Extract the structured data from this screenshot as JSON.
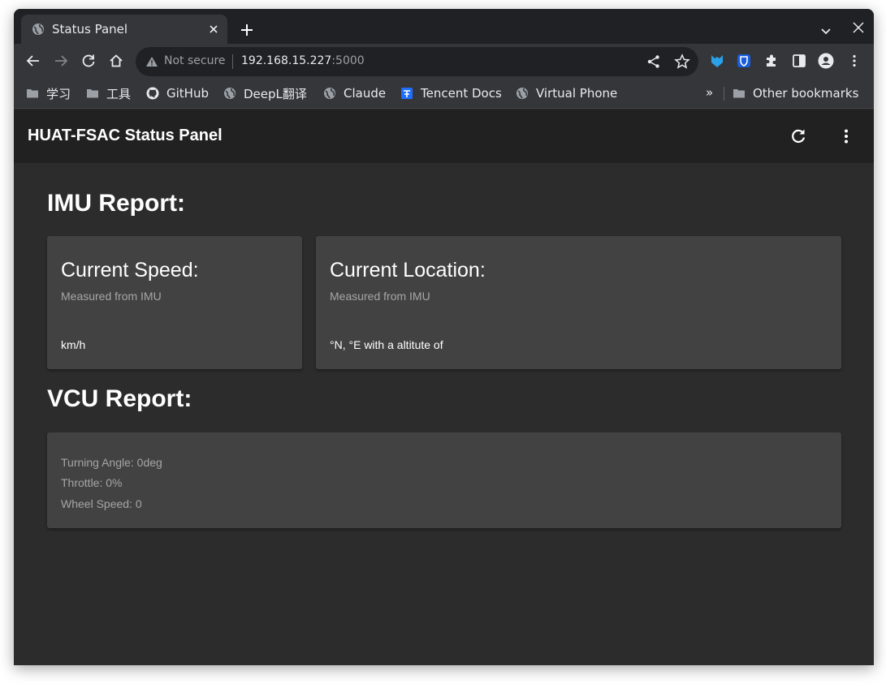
{
  "browser": {
    "tab_title": "Status Panel",
    "omnibox": {
      "security_label": "Not secure",
      "url_host": "192.168.15.227",
      "url_port": ":5000"
    },
    "bookmarks": [
      {
        "label": "学习",
        "icon": "folder-icon"
      },
      {
        "label": "工具",
        "icon": "folder-icon"
      },
      {
        "label": "GitHub",
        "icon": "github-icon"
      },
      {
        "label": "DeepL翻译",
        "icon": "globe-icon"
      },
      {
        "label": "Claude",
        "icon": "globe-icon"
      },
      {
        "label": "Tencent Docs",
        "icon": "tencent-docs-icon"
      },
      {
        "label": "Virtual Phone",
        "icon": "globe-icon"
      }
    ],
    "bookmarks_overflow": "»",
    "other_bookmarks": "Other bookmarks"
  },
  "app": {
    "title": "HUAT-FSAC Status Panel"
  },
  "imu": {
    "heading": "IMU Report:",
    "speed_card": {
      "title": "Current Speed:",
      "subtitle": "Measured from IMU",
      "value": "km/h"
    },
    "location_card": {
      "title": "Current Location:",
      "subtitle": "Measured from IMU",
      "value": "°N, °E with a altitute of"
    }
  },
  "vcu": {
    "heading": "VCU Report:",
    "lines": [
      "Turning Angle: 0deg",
      "Throttle: 0%",
      "Wheel Speed: 0"
    ]
  },
  "colors": {
    "tabstrip": "#202124",
    "toolbar": "#35363a",
    "appbar": "#212121",
    "background": "#2c2c2c",
    "card": "#424242"
  }
}
